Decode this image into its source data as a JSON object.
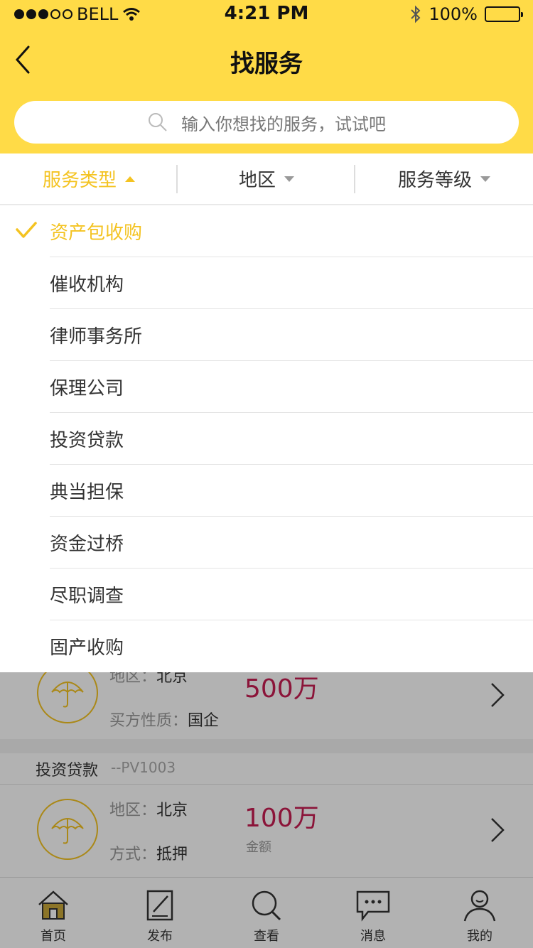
{
  "status_bar": {
    "carrier": "BELL",
    "time": "4:21 PM",
    "battery": "100%"
  },
  "nav": {
    "title": "找服务"
  },
  "search": {
    "placeholder": "输入你想找的服务，试试吧"
  },
  "filters": [
    {
      "label": "服务类型",
      "state": "open"
    },
    {
      "label": "地区",
      "state": "closed"
    },
    {
      "label": "服务等级",
      "state": "closed"
    }
  ],
  "dropdown": {
    "options": [
      "资产包收购",
      "催收机构",
      "律师事务所",
      "保理公司",
      "投资贷款",
      "典当担保",
      "资金过桥",
      "尽职调查",
      "固产收购"
    ],
    "selected": "资产包收购"
  },
  "list": {
    "item1": {
      "region_label": "地区：",
      "region": "北京",
      "buyer_label": "买方性质：",
      "buyer": "国企",
      "amount": "500万"
    },
    "item2": {
      "category": "投资贷款",
      "code": "--PV1003",
      "region_label": "地区：",
      "region": "北京",
      "method_label": "方式：",
      "method": "抵押",
      "amount": "100万",
      "amount_label": "金额"
    }
  },
  "tabbar": [
    {
      "label": "首页",
      "icon": "home-icon"
    },
    {
      "label": "发布",
      "icon": "edit-icon"
    },
    {
      "label": "查看",
      "icon": "search-icon"
    },
    {
      "label": "消息",
      "icon": "message-icon"
    },
    {
      "label": "我的",
      "icon": "user-icon"
    }
  ],
  "colors": {
    "accent": "#ffdb47",
    "selected_text": "#f4c321",
    "amount": "#c81d52"
  }
}
